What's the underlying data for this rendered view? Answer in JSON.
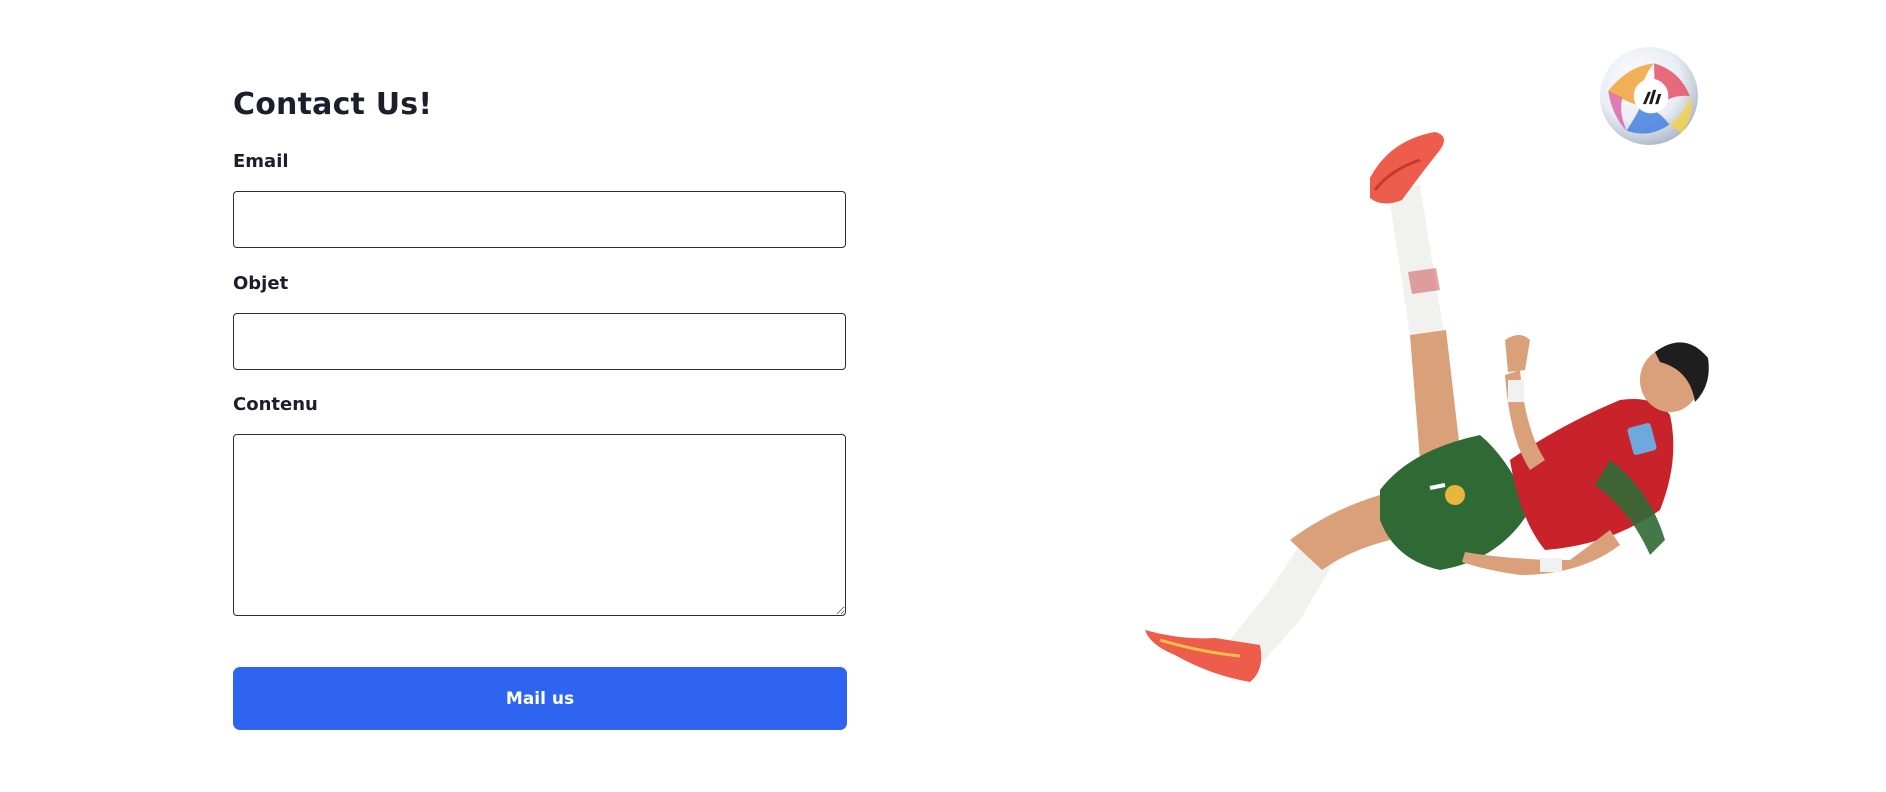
{
  "form": {
    "title": "Contact Us!",
    "email_label": "Email",
    "email_value": "",
    "objet_label": "Objet",
    "objet_value": "",
    "contenu_label": "Contenu",
    "contenu_value": "",
    "submit_label": "Mail us"
  },
  "colors": {
    "accent": "#2f64f0",
    "text": "#1b1e2b",
    "border": "#2b2d36",
    "jersey_red": "#c8222a",
    "shorts_green": "#2f6a35"
  },
  "illustration": {
    "ball_icon": "soccer-ball-icon",
    "player_icon": "bicycle-kick-player-illustration"
  }
}
